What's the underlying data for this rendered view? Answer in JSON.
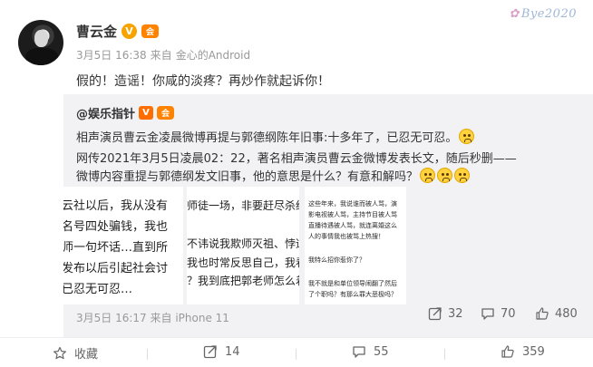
{
  "author": {
    "name": "曹云金",
    "vip_badge": "V",
    "member_badge": "会"
  },
  "meta": {
    "date": "3月5日 16:38",
    "source_prefix": "来自",
    "source": "金心的Android"
  },
  "post": {
    "text": "假的！造谣！你咸的淡疼？再炒作就起诉你！"
  },
  "watermark": {
    "text": "Bye2020"
  },
  "repost": {
    "author": "@娱乐指针",
    "vip_badge": "V",
    "line1": "相声演员曹云金凌晨微博再提与郭德纲陈年旧事:十多年了，已忍无可忍。",
    "line2": "网传2021年3月5日凌晨02：22，著名相声演员曹云金微博发表长文，随后秒删——",
    "line3": "微博内容重提与郭德纲发文旧事，他的意思是什么？有意和解吗？",
    "thumb1": [
      "云社以后，我从没有",
      "名号四处骗钱，我也",
      "师一句坏话…直到所",
      "发布以后引起社会讨",
      "已忍无可忍…"
    ],
    "thumb2": [
      "师徒一场，非要赶尽杀绝",
      "",
      "不讳说我欺师灭祖、悖逆",
      "我也时常反思自己，我看",
      "？我到底把郭老师怎么着"
    ],
    "thumb3": [
      "这些年来，我说谁而被人骂，演",
      "影电视被人骂，主持节目被人骂",
      "直播待遇被人骂，就连离婚这么",
      "人的事情我也被骂上热搜！",
      "",
      "我特么招你惹你了？",
      "",
      "我不就是和单位领导闹翻了然后",
      "了个职吗？有那么罪大恶极吗？"
    ],
    "date": "3月5日 16:17",
    "source_prefix": "来自",
    "source": "iPhone 11",
    "share_count": "32",
    "comment_count": "70",
    "like_count": "480"
  },
  "footer": {
    "favorite_label": "收藏",
    "share_count": "14",
    "comment_count": "55",
    "like_count": "359"
  },
  "colors": {
    "accent_orange": "#ff8200",
    "repost_bg": "#f2f2f5",
    "meta_gray": "#999999"
  }
}
